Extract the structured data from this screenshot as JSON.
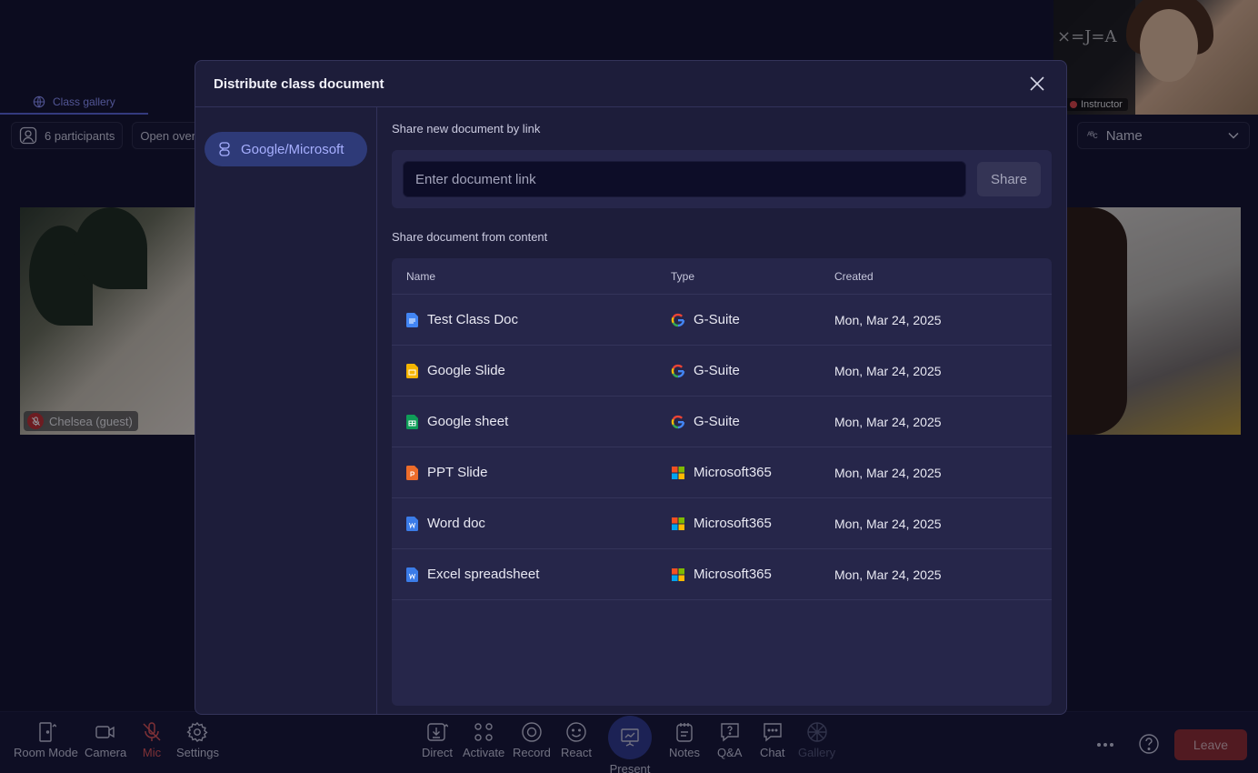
{
  "background": {
    "tabs": [
      {
        "label": "Class gallery"
      }
    ],
    "participants_label": "6 participants",
    "overlay_label": "Open overla",
    "sort": {
      "label": "Name"
    },
    "instructor_tag": "Instructor",
    "guest_name": "Chelsea (guest)"
  },
  "bottom_bar": {
    "left": [
      {
        "label": "Room Mode",
        "icon": "door-icon"
      },
      {
        "label": "Camera",
        "icon": "camera-icon"
      },
      {
        "label": "Mic",
        "icon": "mic-off-icon"
      },
      {
        "label": "Settings",
        "icon": "gear-icon"
      }
    ],
    "center": [
      {
        "label": "Direct",
        "icon": "download-icon"
      },
      {
        "label": "Activate",
        "icon": "activate-icon"
      },
      {
        "label": "Record",
        "icon": "record-icon"
      },
      {
        "label": "React",
        "icon": "smile-icon"
      },
      {
        "label": "Present",
        "icon": "present-icon"
      },
      {
        "label": "Notes",
        "icon": "notes-icon"
      },
      {
        "label": "Q&A",
        "icon": "qa-icon"
      },
      {
        "label": "Chat",
        "icon": "chat-icon"
      },
      {
        "label": "Gallery",
        "icon": "grid-icon"
      }
    ],
    "leave_label": "Leave"
  },
  "modal": {
    "title": "Distribute class document",
    "nav": [
      {
        "label": "Google/Microsoft",
        "active": true
      }
    ],
    "link_section_label": "Share new document by link",
    "link_placeholder": "Enter document link",
    "share_label": "Share",
    "content_section_label": "Share document from content",
    "columns": {
      "name": "Name",
      "type": "Type",
      "created": "Created"
    },
    "rows": [
      {
        "name": "Test Class Doc",
        "type": "G-Suite",
        "created": "Mon, Mar 24, 2025",
        "file_icon": "google-doc-icon",
        "type_icon": "google-icon"
      },
      {
        "name": "Google Slide",
        "type": "G-Suite",
        "created": "Mon, Mar 24, 2025",
        "file_icon": "google-slide-icon",
        "type_icon": "google-icon"
      },
      {
        "name": "Google sheet",
        "type": "G-Suite",
        "created": "Mon, Mar 24, 2025",
        "file_icon": "google-sheet-icon",
        "type_icon": "google-icon"
      },
      {
        "name": "PPT Slide",
        "type": "Microsoft365",
        "created": "Mon, Mar 24, 2025",
        "file_icon": "ppt-icon",
        "type_icon": "microsoft-icon"
      },
      {
        "name": "Word doc",
        "type": "Microsoft365",
        "created": "Mon, Mar 24, 2025",
        "file_icon": "word-icon",
        "type_icon": "microsoft-icon"
      },
      {
        "name": "Excel spreadsheet",
        "type": "Microsoft365",
        "created": "Mon, Mar 24, 2025",
        "file_icon": "word-icon",
        "type_icon": "microsoft-icon"
      }
    ]
  },
  "colors": {
    "accent": "#5a64d8",
    "leave": "#8f2a2f",
    "mic_off": "#e05454"
  }
}
